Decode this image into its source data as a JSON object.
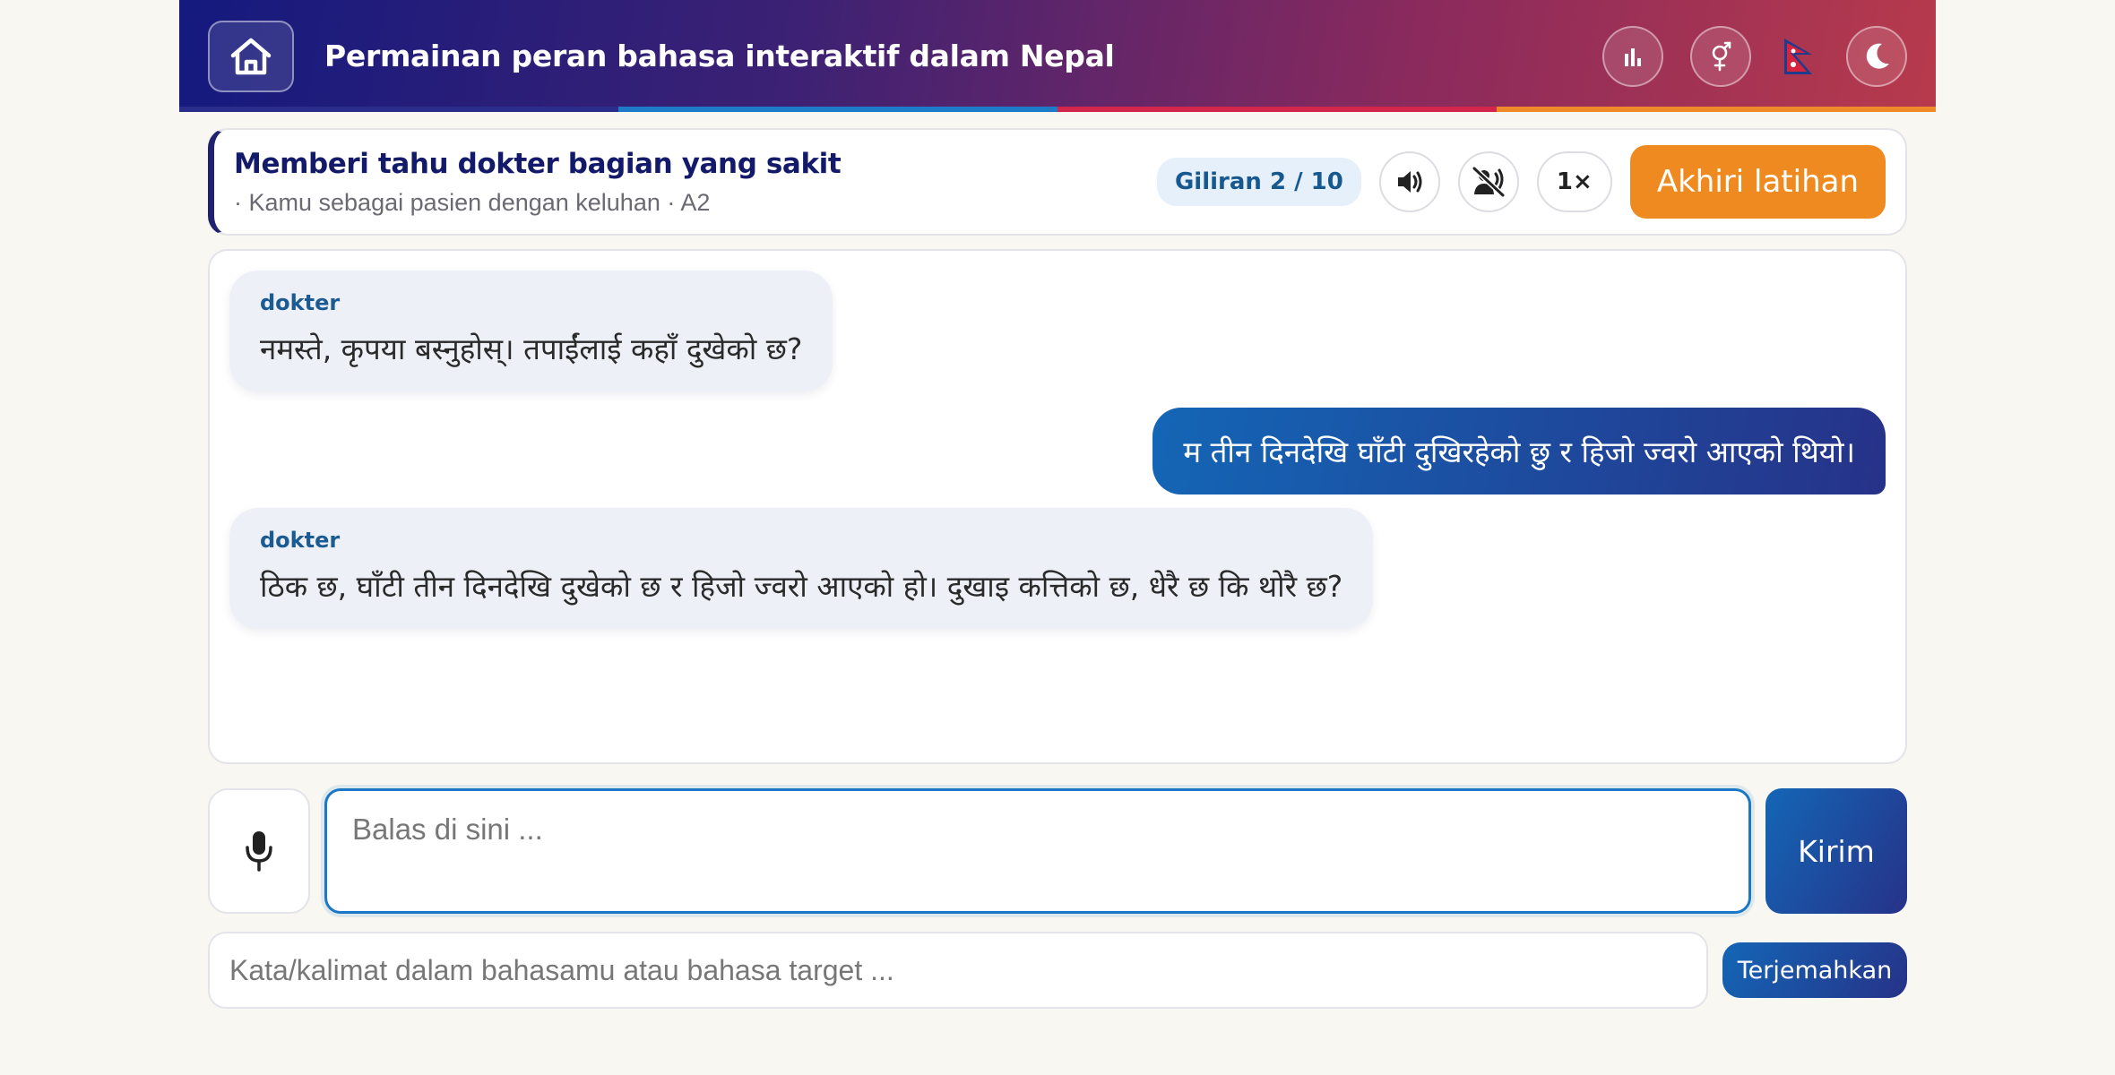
{
  "header": {
    "title": "Permainan peran bahasa interaktif dalam Nepal",
    "home_icon": "home-icon",
    "actions": [
      "stats-icon",
      "gender-icon",
      "nepal-flag-icon",
      "moon-icon"
    ],
    "stripe_colors": [
      "#2a2d8a",
      "#1e7bc7",
      "#d2264a",
      "#ee8a2a"
    ]
  },
  "scenario": {
    "title": "Memberi tahu dokter bagian yang sakit",
    "subtitle": "· Kamu sebagai pasien dengan keluhan · A2",
    "turn": "Giliran 2 / 10",
    "speed": "1×",
    "end_label": "Akhiri latihan"
  },
  "chat": {
    "messages": [
      {
        "role": "partner",
        "sender": "dokter",
        "text": "नमस्ते, कृपया बस्नुहोस्। तपाईंलाई कहाँ दुखेको छ?"
      },
      {
        "role": "user",
        "text": "म तीन दिनदेखि घाँटी दुखिरहेको छु र हिजो ज्वरो आएको थियो।"
      },
      {
        "role": "partner",
        "sender": "dokter",
        "text": "ठिक छ, घाँटी तीन दिनदेखि दुखेको छ र हिजो ज्वरो आएको हो। दुखाइ कत्तिको छ, धेरै छ कि थोरै छ?"
      }
    ]
  },
  "composer": {
    "reply_placeholder": "Balas di sini ...",
    "send_label": "Kirim",
    "translate_placeholder": "Kata/kalimat dalam bahasamu atau bahasa target ...",
    "translate_label": "Terjemahkan"
  },
  "colors": {
    "accent": "#1466b6",
    "end_button": "#ef8a21",
    "sender": "#1c5a92"
  }
}
